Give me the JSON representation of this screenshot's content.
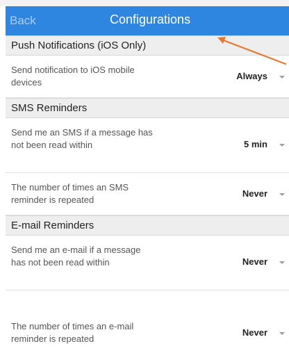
{
  "nav": {
    "back_label": "Back",
    "title": "Configurations"
  },
  "sections": [
    {
      "title": "Push Notifications (iOS Only)",
      "rows": [
        {
          "label": "Send notification to iOS mobile devices",
          "value": "Always"
        }
      ]
    },
    {
      "title": "SMS Reminders",
      "rows": [
        {
          "label": "Send me an SMS if a message has not been read within",
          "value": "5 min"
        },
        {
          "label": "The number of times an SMS reminder is repeated",
          "value": "Never"
        }
      ]
    },
    {
      "title": "E-mail Reminders",
      "rows": [
        {
          "label": "Send me an e-mail if a message has not been read within",
          "value": "Never"
        },
        {
          "label": "The number of times an e-mail reminder is repeated",
          "value": "Never"
        }
      ]
    }
  ],
  "colors": {
    "nav_background": "#2f86e1",
    "annotation_arrow": "#e87a2f"
  }
}
